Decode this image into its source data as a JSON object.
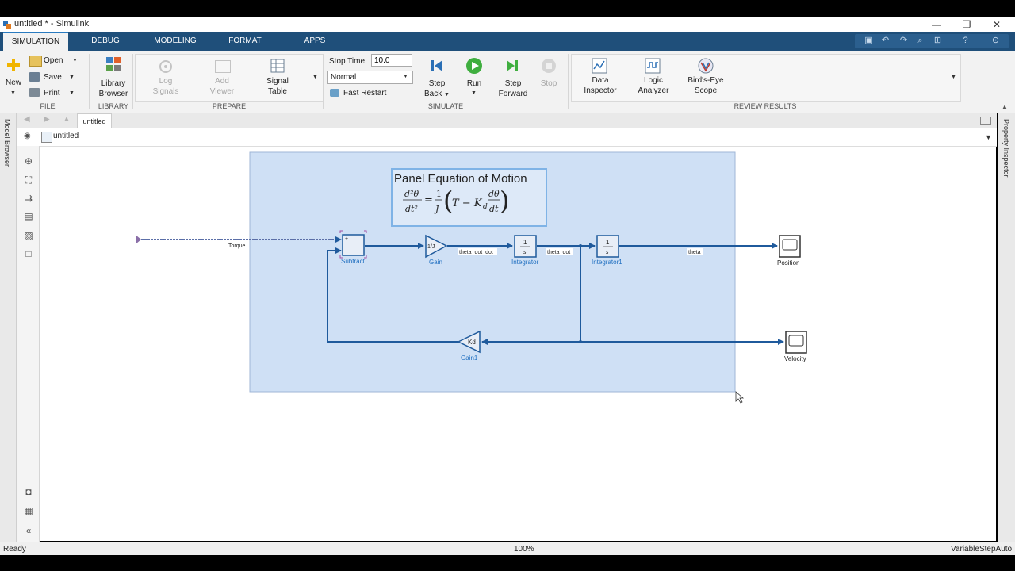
{
  "window": {
    "title": "untitled * - Simulink",
    "controls": [
      "—",
      "❐",
      "✕"
    ]
  },
  "tabs": [
    {
      "label": "SIMULATION",
      "active": true
    },
    {
      "label": "DEBUG"
    },
    {
      "label": "MODELING"
    },
    {
      "label": "FORMAT"
    },
    {
      "label": "APPS"
    }
  ],
  "ribbon": {
    "file": {
      "group": "FILE",
      "new": "New",
      "open": "Open",
      "save": "Save",
      "print": "Print"
    },
    "library": {
      "group": "LIBRARY",
      "label1": "Library",
      "label2": "Browser"
    },
    "prepare": {
      "group": "PREPARE",
      "log1": "Log",
      "log2": "Signals",
      "add1": "Add",
      "add2": "Viewer",
      "sig1": "Signal",
      "sig2": "Table"
    },
    "simulate": {
      "group": "SIMULATE",
      "stop_time_label": "Stop Time",
      "stop_time_value": "10.0",
      "mode": "Normal",
      "fast_restart": "Fast Restart",
      "step_back1": "Step",
      "step_back2": "Back",
      "run": "Run",
      "step_fwd1": "Step",
      "step_fwd2": "Forward",
      "stop": "Stop"
    },
    "review": {
      "group": "REVIEW RESULTS",
      "di1": "Data",
      "di2": "Inspector",
      "la1": "Logic",
      "la2": "Analyzer",
      "be1": "Bird's-Eye",
      "be2": "Scope"
    }
  },
  "editor": {
    "tab": "untitled",
    "breadcrumb": "untitled"
  },
  "side_panels": {
    "left": "Model Browser",
    "right": "Property Inspector"
  },
  "diagram": {
    "annotation_title": "Panel Equation of Motion",
    "equation": {
      "lhs_num": "d²θ",
      "lhs_den": "dt²",
      "eq": "=",
      "one": "1",
      "j": "J",
      "inner_left": "T − K",
      "kd_sub": "d",
      "dtheta": "dθ",
      "dt": "dt"
    },
    "blocks": {
      "subtract": "Subtract",
      "subtract_plus": "+",
      "subtract_minus": "–",
      "gain": "Gain",
      "gain_value": "1/J",
      "integrator": "Integrator",
      "integrator1": "Integrator1",
      "int_num": "1",
      "int_den": "s",
      "gain1": "Gain1",
      "gain1_value": "Kd",
      "position": "Position",
      "velocity": "Velocity"
    },
    "signals": {
      "torque": "Torque",
      "theta_dot_dot": "theta_dot_dot",
      "theta_dot": "theta_dot",
      "theta": "theta"
    },
    "colors": {
      "selection_fill": "#cfe0f5",
      "selection_border": "#9fb6d6",
      "wire": "#1f5a9c",
      "block_label": "#1f6fc0"
    }
  },
  "status": {
    "left": "Ready",
    "zoom": "100%",
    "solver": "VariableStepAuto"
  }
}
